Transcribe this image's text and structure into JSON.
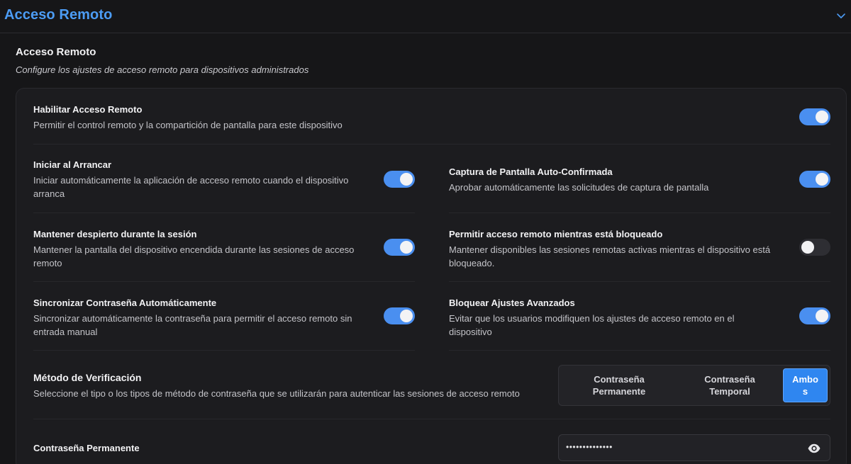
{
  "header": {
    "title": "Acceso Remoto",
    "collapse_icon": "chevron-down-icon",
    "accent_color": "#4c9cf4"
  },
  "section": {
    "title": "Acceso Remoto",
    "subtitle": "Configure los ajustes de acceso remoto para dispositivos administrados"
  },
  "settings": {
    "enable": {
      "title": "Habilitar Acceso Remoto",
      "desc": "Permitir el control remoto y la compartición de pantalla para este dispositivo",
      "enabled": true
    },
    "start_on_boot": {
      "title": "Iniciar al Arrancar",
      "desc": "Iniciar automáticamente la aplicación de acceso remoto cuando el dispositivo arranca",
      "enabled": true
    },
    "auto_confirm_capture": {
      "title": "Captura de Pantalla Auto-Confirmada",
      "desc": "Aprobar automáticamente las solicitudes de captura de pantalla",
      "enabled": true
    },
    "keep_awake": {
      "title": "Mantener despierto durante la sesión",
      "desc": "Mantener la pantalla del dispositivo encendida durante las sesiones de acceso remoto",
      "enabled": true
    },
    "allow_while_locked": {
      "title": "Permitir acceso remoto mientras está bloqueado",
      "desc": "Mantener disponibles las sesiones remotas activas mientras el dispositivo está bloqueado.",
      "enabled": false
    },
    "sync_password": {
      "title": "Sincronizar Contraseña Automáticamente",
      "desc": "Sincronizar automáticamente la contraseña para permitir el acceso remoto sin entrada manual",
      "enabled": true
    },
    "lock_advanced": {
      "title": "Bloquear Ajustes Avanzados",
      "desc": "Evitar que los usuarios modifiquen los ajustes de acceso remoto en el dispositivo",
      "enabled": true
    }
  },
  "verification": {
    "title": "Método de Verificación",
    "desc": "Seleccione el tipo o los tipos de método de contraseña que se utilizarán para autenticar las sesiones de acceso remoto",
    "options": [
      {
        "line1": "Contraseña",
        "line2": "Permanente"
      },
      {
        "line1": "Contraseña",
        "line2": "Temporal"
      },
      {
        "line1": "Ambo",
        "line2": "s"
      }
    ],
    "selected": "Ambos"
  },
  "permanent_password": {
    "label": "Contraseña Permanente",
    "value": "••••••••••••••",
    "reveal_icon": "eye-icon"
  },
  "colors": {
    "toggle_on": "#4a8ff0",
    "toggle_off": "#2e2e33",
    "segment_active": "#2f86f0"
  }
}
